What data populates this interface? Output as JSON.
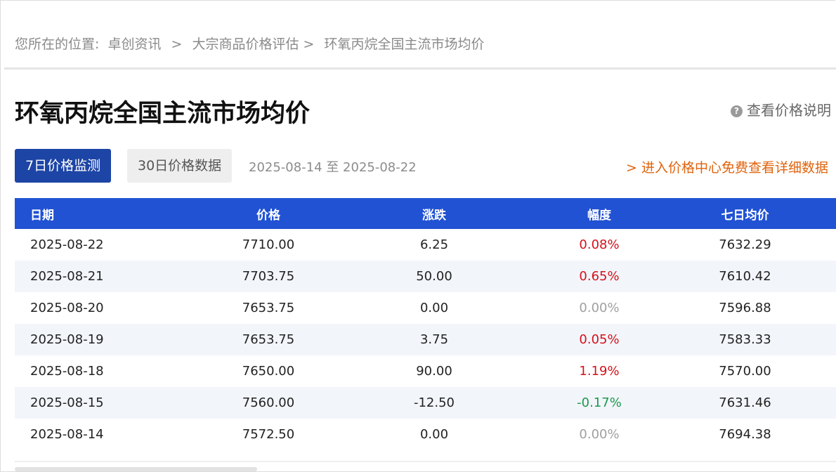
{
  "breadcrumb": {
    "prefix": "您所在的位置:",
    "items": [
      "卓创资讯",
      "大宗商品价格评估",
      "环氧丙烷全国主流市场均价"
    ],
    "separators": [
      ">",
      ">"
    ]
  },
  "page_title": "环氧丙烷全国主流市场均价",
  "help_link": "查看价格说明",
  "tabs": [
    {
      "label": "7日价格监测",
      "active": true
    },
    {
      "label": "30日价格数据",
      "active": false
    }
  ],
  "date_range": "2025-08-14 至 2025-08-22",
  "promo_link": "> 进入价格中心免费查看详细数据",
  "table": {
    "headers": [
      "日期",
      "价格",
      "涨跌",
      "幅度",
      "七日均价"
    ],
    "rows": [
      {
        "date": "2025-08-22",
        "price": "7710.00",
        "change": "6.25",
        "pct": "0.08%",
        "trend": "up",
        "avg7": "7632.29"
      },
      {
        "date": "2025-08-21",
        "price": "7703.75",
        "change": "50.00",
        "pct": "0.65%",
        "trend": "up",
        "avg7": "7610.42"
      },
      {
        "date": "2025-08-20",
        "price": "7653.75",
        "change": "0.00",
        "pct": "0.00%",
        "trend": "flat",
        "avg7": "7596.88"
      },
      {
        "date": "2025-08-19",
        "price": "7653.75",
        "change": "3.75",
        "pct": "0.05%",
        "trend": "up",
        "avg7": "7583.33"
      },
      {
        "date": "2025-08-18",
        "price": "7650.00",
        "change": "90.00",
        "pct": "1.19%",
        "trend": "up",
        "avg7": "7570.00"
      },
      {
        "date": "2025-08-15",
        "price": "7560.00",
        "change": "-12.50",
        "pct": "-0.17%",
        "trend": "down",
        "avg7": "7631.46"
      },
      {
        "date": "2025-08-14",
        "price": "7572.50",
        "change": "0.00",
        "pct": "0.00%",
        "trend": "flat",
        "avg7": "7694.38"
      }
    ]
  },
  "colors": {
    "header_bg": "#2152d3",
    "active_tab": "#1d45a6",
    "up": "#d4111b",
    "down": "#1a9a4c",
    "flat": "#a0a0a0",
    "promo": "#e0630c"
  },
  "icons": {
    "help": "question-circle-icon"
  }
}
